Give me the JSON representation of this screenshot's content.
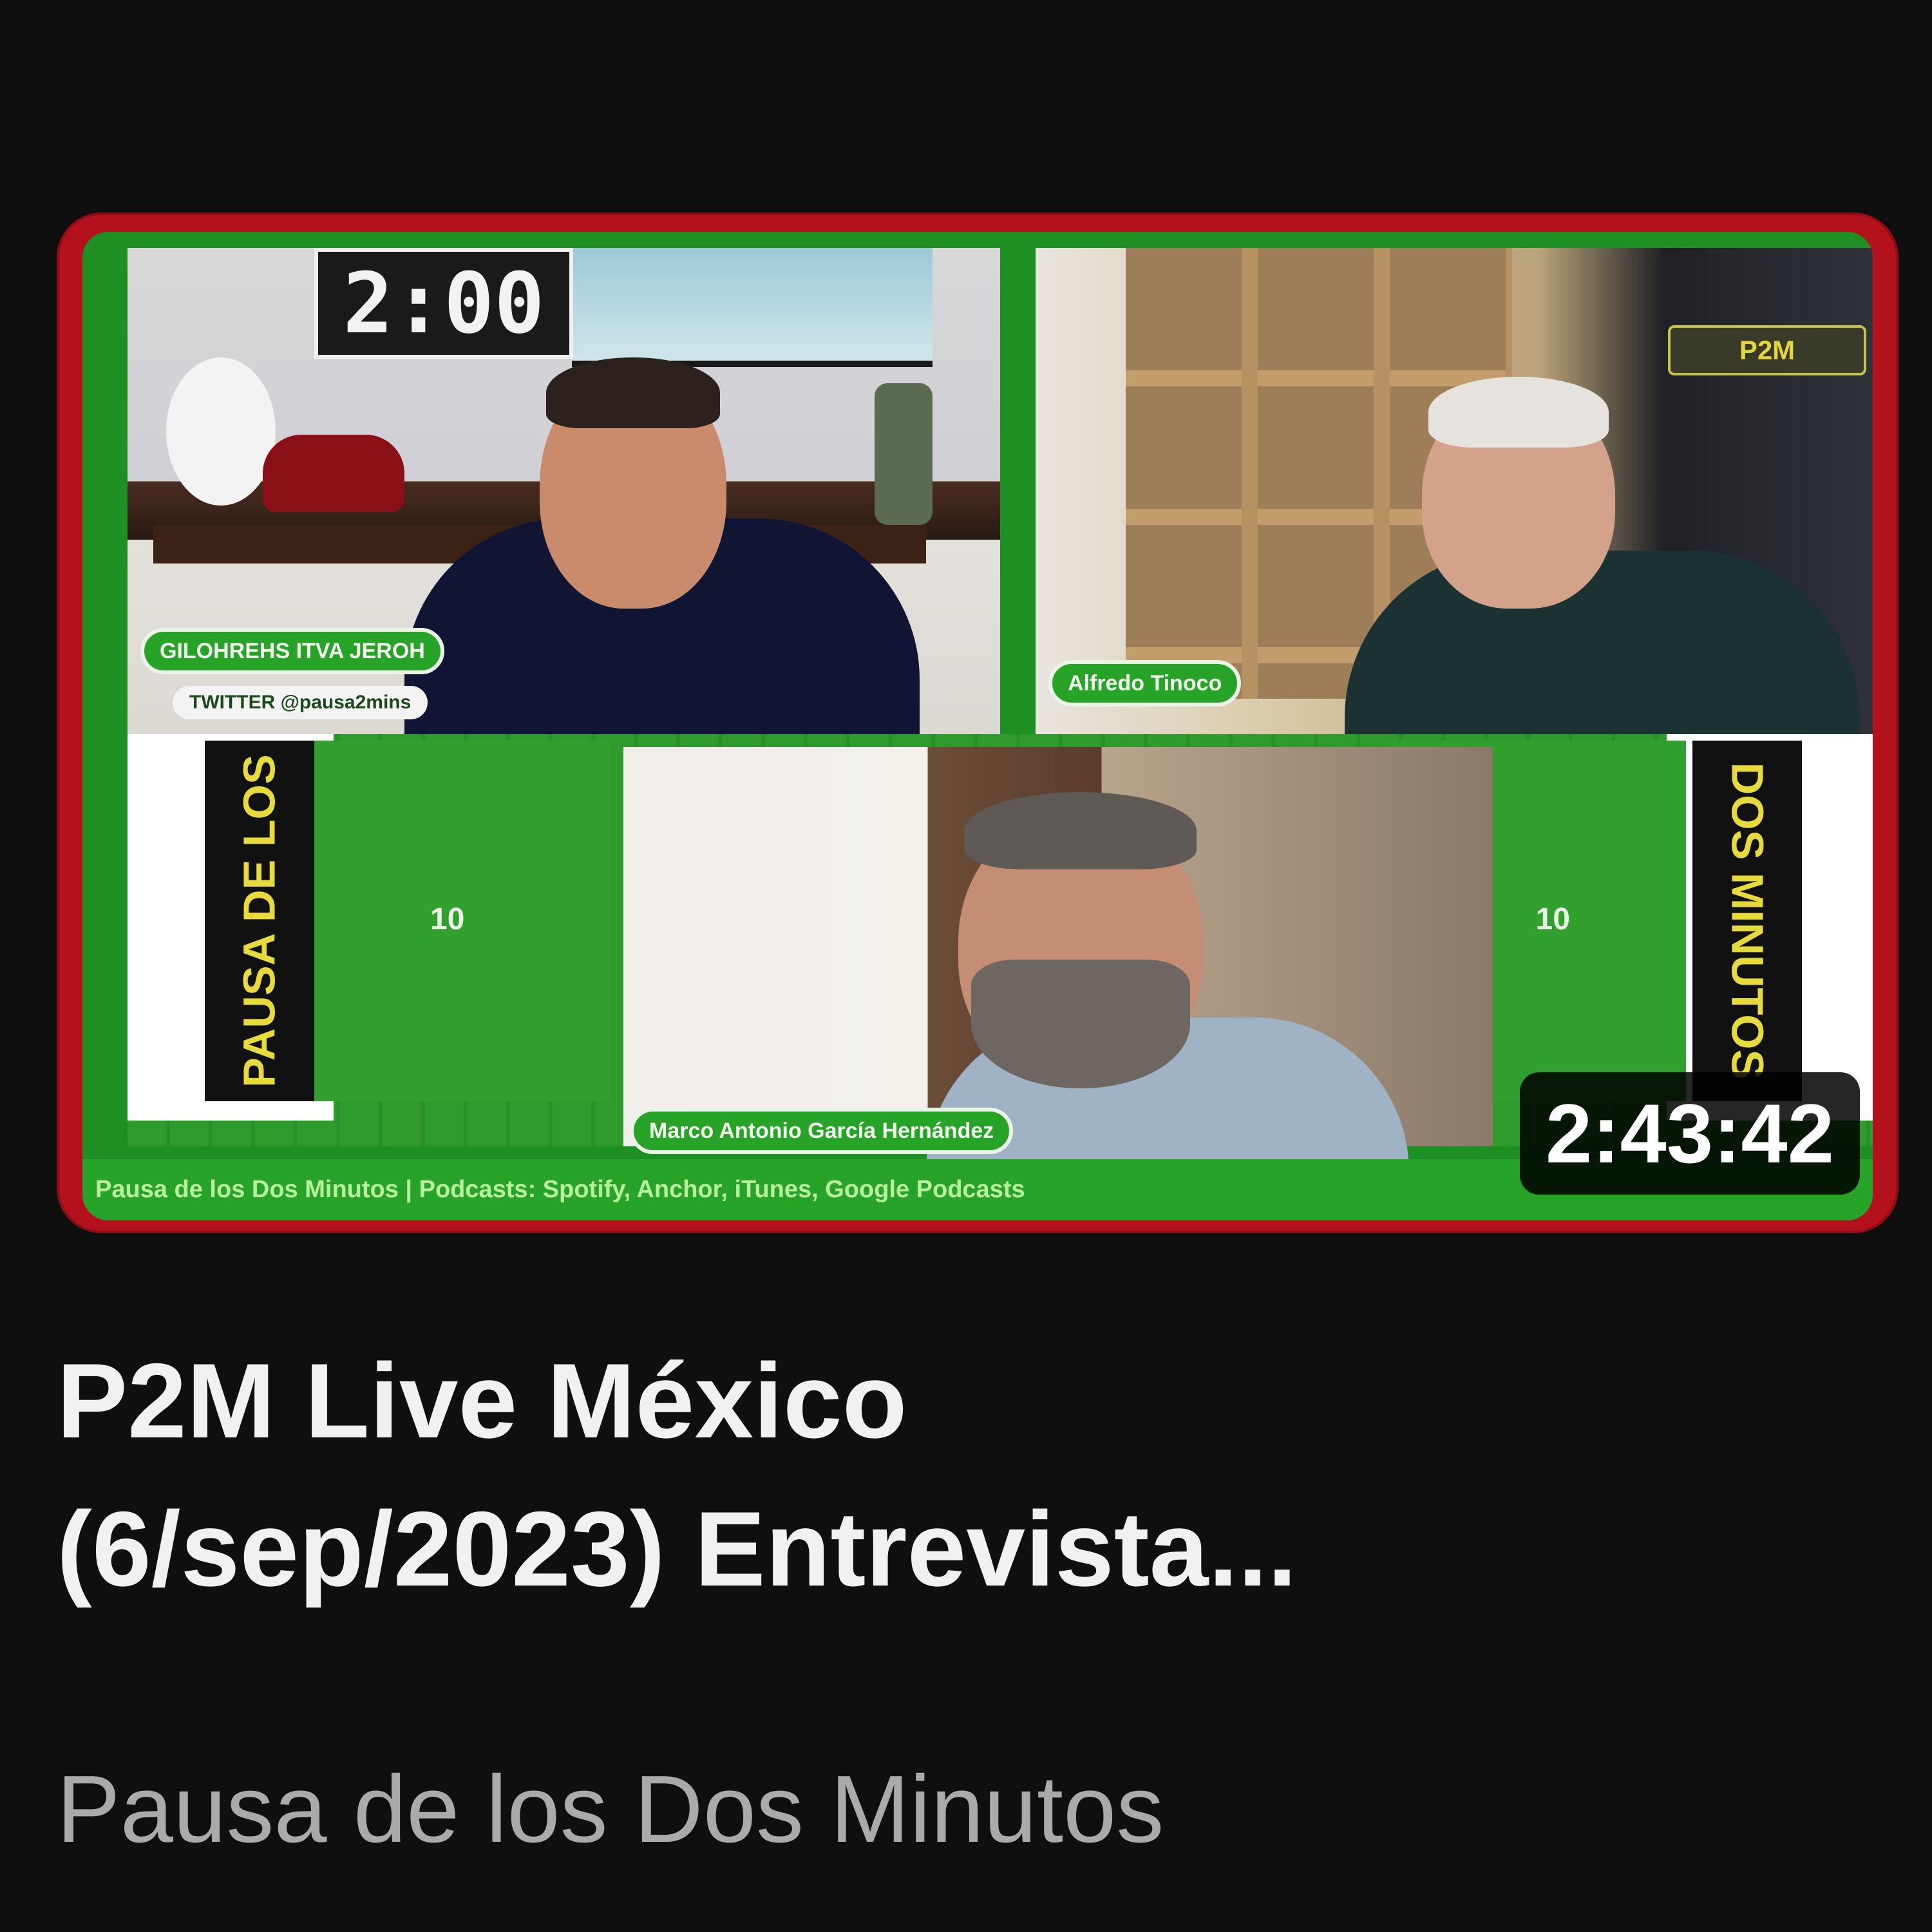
{
  "thumbnail": {
    "scoreboard_text": "2:00",
    "duration": "2:43:42",
    "nametag_1": "GILOHREHS ITVA JEROH",
    "subtag_1": "TWITTER @pausa2mins",
    "nametag_2": "Alfredo Tinoco",
    "nametag_3": "Marco Antonio García Hernández",
    "banner_left": "PAUSA DE LOS",
    "banner_right": "DOS MINUTOS",
    "logo_chip": "P2M",
    "ticker": "Pausa de los Dos Minutos | Podcasts: Spotify, Anchor, iTunes, Google Podcasts",
    "yard_marker_1": "10",
    "yard_marker_2": "10",
    "colors": {
      "frame": "#b3121d",
      "field": "#2f9b2c",
      "tag": "#27a327",
      "banner_text": "#e6da3c"
    }
  },
  "video": {
    "title_line_1": "P2M Live México",
    "title_line_2": "(6/sep/2023) Entrevista...",
    "channel": "Pausa de los Dos Minutos"
  }
}
